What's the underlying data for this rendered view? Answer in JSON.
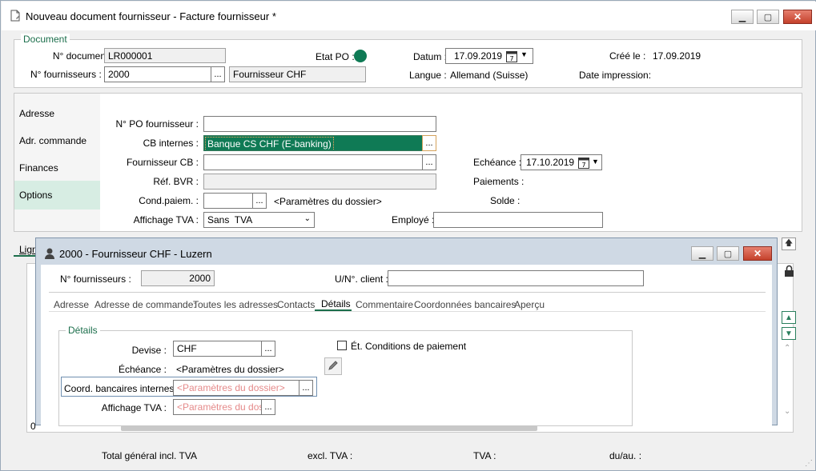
{
  "main": {
    "title": "Nouveau document fournisseur - Facture fournisseur *",
    "document_group": "Document",
    "doc_no_label": "N° document :",
    "doc_no_value": "LR000001",
    "etat_po_label": "Etat PO :",
    "status_color": "#0f7a55",
    "datum_label": "Datum :",
    "datum_value": "17.09.2019",
    "cree_le_label": "Créé le :",
    "cree_le_value": "17.09.2019",
    "supplier_no_label": "N° fournisseurs :",
    "supplier_no_value": "2000",
    "supplier_name": "Fournisseur CHF",
    "langue_label": "Langue :",
    "langue_value": "Allemand (Suisse)",
    "date_impression_label": "Date impression:",
    "dots": "..."
  },
  "sidebar": {
    "items": [
      {
        "label": "Adresse"
      },
      {
        "label": "Adr. commande"
      },
      {
        "label": "Finances"
      },
      {
        "label": "Options"
      }
    ]
  },
  "form": {
    "po_label": "N° PO fournisseur :",
    "po_value": "",
    "cb_internes_label": "CB internes :",
    "cb_internes_value": "Banque CS CHF (E-banking)",
    "fournisseur_cb_label": "Fournisseur CB :",
    "fournisseur_cb_value": "",
    "ref_bvr_label": "Réf. BVR :",
    "cond_paiem_label": "Cond.paiem. :",
    "cond_paiem_value": "",
    "cond_paiem_params": "<Paramètres du dossier>",
    "affichage_tva_label": "Affichage TVA :",
    "affichage_tva_value": "Sans  TVA",
    "echeance_label": "Echéance :",
    "echeance_value": "17.10.2019",
    "paiements_label": "Paiements :",
    "solde_label": "Solde :",
    "employe_label": "Employé :",
    "employe_value": ""
  },
  "lines_tab": "Lign",
  "footer": {
    "total_label": "Total général incl. TVA",
    "excl_label": "excl. TVA :",
    "tva_label": "TVA :",
    "duau_label": "du/au. :",
    "zero": "0"
  },
  "popup": {
    "title": "2000 - Fournisseur CHF - Luzern",
    "supplier_no_label": "N° fournisseurs :",
    "supplier_no_value": "2000",
    "client_no_label": "U/N°. client :",
    "client_no_value": "",
    "tabs": [
      {
        "label": "Adresse"
      },
      {
        "label": "Adresse de commande:"
      },
      {
        "label": "Toutes les adresses"
      },
      {
        "label": "Contacts"
      },
      {
        "label": "Détails"
      },
      {
        "label": "Commentaire"
      },
      {
        "label": "Coordonnées bancaires"
      },
      {
        "label": "Aperçu"
      }
    ],
    "details_group": "Détails",
    "devise_label": "Devise :",
    "devise_value": "CHF",
    "conditions_label": "Ét. Conditions de paiement",
    "echeance_label": "Échéance :",
    "echeance_value": "<Paramètres du dossier>",
    "coord_label": "Coord. bancaires internes :",
    "coord_placeholder": "<Paramètres du dossier>",
    "affichage_label": "Affichage TVA :",
    "affichage_placeholder": "<Paramètres du dossier>"
  },
  "colors": {
    "accent_green": "#1b6e4b",
    "selection": "#0f7a55",
    "placeholder_red": "#e58a8a"
  }
}
